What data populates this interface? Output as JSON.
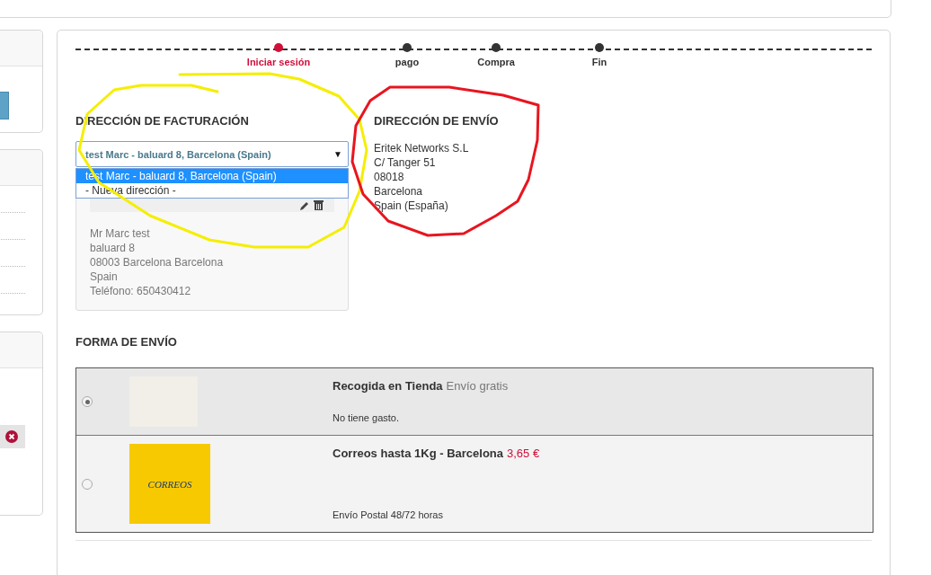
{
  "steps": [
    {
      "label": "Iniciar sesión",
      "selected": true
    },
    {
      "label": "pago",
      "selected": false
    },
    {
      "label": "Compra",
      "selected": false
    },
    {
      "label": "Fin",
      "selected": false
    }
  ],
  "billing": {
    "title": "DIRECCIÓN DE FACTURACIÓN",
    "select_value": "test Marc - baluard 8, Barcelona (Spain)",
    "dropdown_arrow": "▼",
    "options": [
      {
        "label": "test Marc - baluard 8, Barcelona (Spain)",
        "selected": true
      },
      {
        "label": "- Nueva dirección -",
        "selected": false
      }
    ],
    "address_lines": [
      "Mr Marc test",
      "baluard 8",
      "08003 Barcelona Barcelona",
      "Spain",
      "Teléfono: 650430412"
    ]
  },
  "shipping_address": {
    "title": "DIRECCIÓN DE ENVÍO",
    "lines": [
      "Eritek Networks S.L",
      "C/ Tanger 51",
      "08018",
      "Barcelona",
      "Spain (España)"
    ]
  },
  "shipping_method": {
    "title": "FORMA DE ENVÍO",
    "options": [
      {
        "kind": "pickup",
        "name": "Recogida en Tienda",
        "price": "Envío gratis",
        "description": "No tiene gasto.",
        "selected": true
      },
      {
        "kind": "courier",
        "logo_text": "CORREOS",
        "name": "Correos hasta 1Kg - Barcelona",
        "price": "3,65 €",
        "description": "Envío Postal 48/72 horas",
        "selected": false
      }
    ]
  }
}
